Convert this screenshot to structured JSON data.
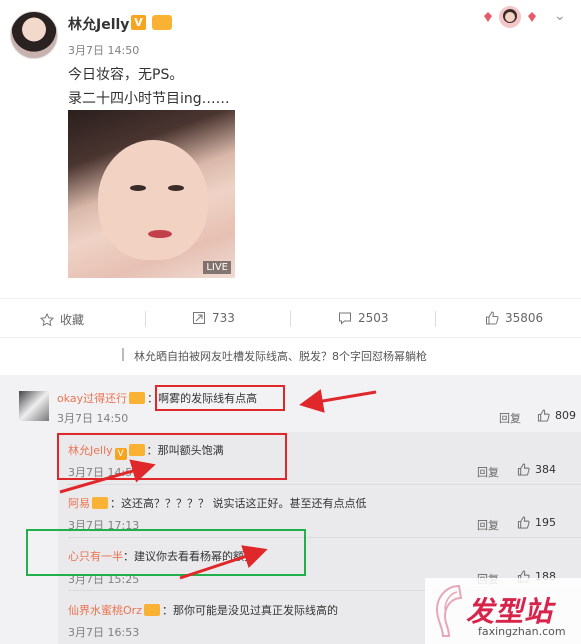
{
  "post": {
    "author": "林允Jelly",
    "verified_badge": "V",
    "time": "3月7日 14:50",
    "line1": "今日妆容，无PS。",
    "line2": "录二十四小时节目ing……",
    "live_badge": "LIVE",
    "menu_icon": "chevron-down-icon"
  },
  "actions": {
    "favorite": "收藏",
    "repost": "733",
    "comment": "2503",
    "like": "35806"
  },
  "related": "林允晒自拍被网友吐槽发际线高、脱发？8个字回怼杨幂躺枪",
  "comments": [
    {
      "user": "okay过得还行",
      "text": "：啊雾的发际线有点高",
      "time": "3月7日 14:50",
      "reply": "回复",
      "likes": "809"
    },
    {
      "user": "林允Jelly",
      "text": "：那叫额头饱满",
      "time": "3月7日 14:5",
      "reply": "回复",
      "likes": "384"
    },
    {
      "user": "阿易",
      "text": "：这还高？？？？？ 说实话这正好。甚至还有点点低",
      "time": "3月7日 17:13",
      "reply": "回复",
      "likes": "195"
    },
    {
      "user": "心只有一半",
      "text": "：建议你去看看杨幂的额头",
      "time": "3月7日 15:25",
      "reply": "回复",
      "likes": "188"
    },
    {
      "user": "仙界水蜜桃Orz",
      "text": "：那你可能是没见过真正发际线高的",
      "time": "3月7日 16:53"
    }
  ],
  "watermark": {
    "brand": "发型站",
    "url": "faxingzhan.com"
  },
  "colors": {
    "username": "#eb7350",
    "annotation_red": "#e0282b",
    "annotation_green": "#22b04a"
  }
}
